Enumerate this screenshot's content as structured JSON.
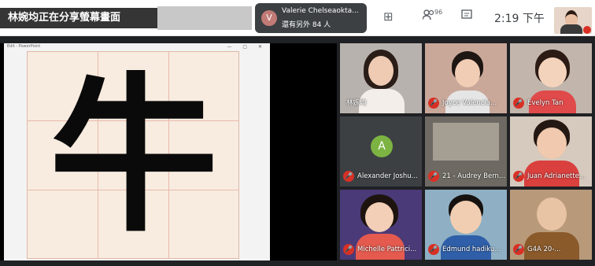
{
  "header": {
    "presenting_text": "林婉均正在分享螢幕畫面",
    "notice_initial": "V",
    "notice_name": "Valerie Chelseaokta...",
    "notice_others": "還有另外 84 人",
    "participants_count": "96",
    "time": "2:19 下午"
  },
  "share": {
    "window_title": "Edit - PowerPoint",
    "character": "牛"
  },
  "participants": [
    {
      "name": "林婉均",
      "muted": false
    },
    {
      "name": "Joyce Valencia...",
      "muted": true
    },
    {
      "name": "Evelyn Tan",
      "muted": true
    },
    {
      "name": "Alexander Joshu...",
      "muted": true,
      "initial": "A"
    },
    {
      "name": "21 - Audrey Bern...",
      "muted": true
    },
    {
      "name": "Juan Adrianette...",
      "muted": true
    },
    {
      "name": "Michelle Pattrici...",
      "muted": true
    },
    {
      "name": "Edmund hadiku...",
      "muted": true
    },
    {
      "name": "G4A 20-...",
      "muted": true
    }
  ],
  "colors": {
    "muted_red": "#d93025",
    "avatar_green": "#7cb342",
    "grid_red": "#e8b9ad"
  }
}
